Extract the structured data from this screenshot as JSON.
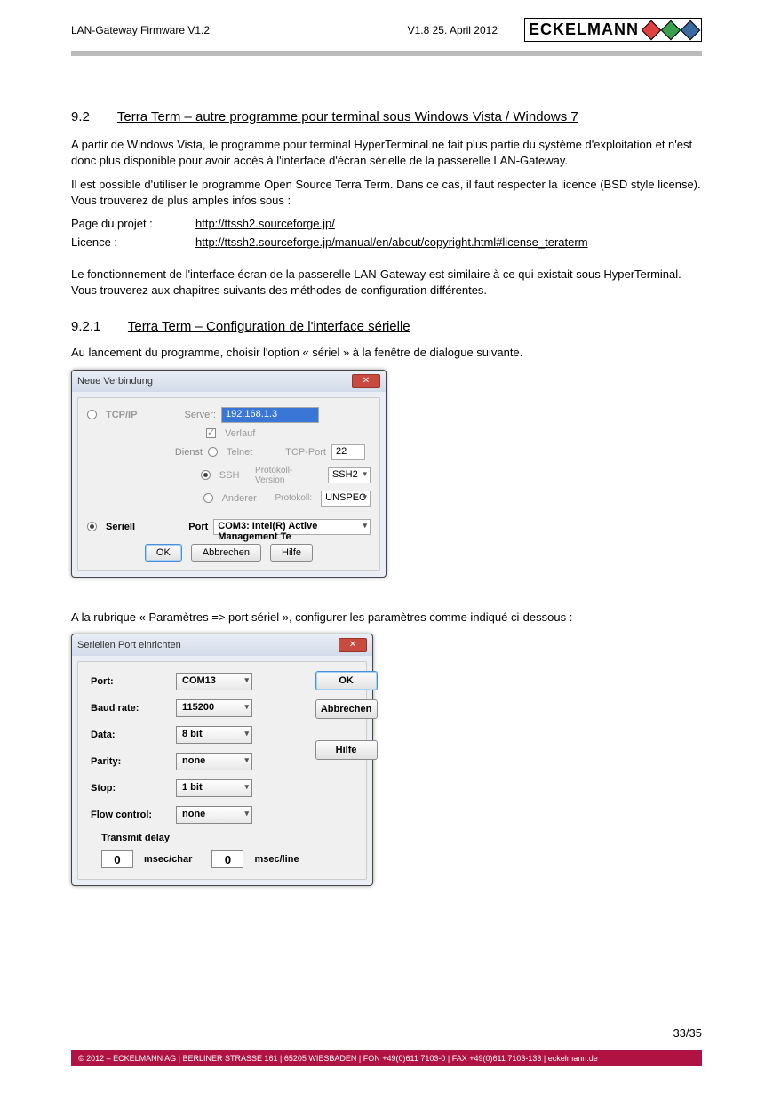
{
  "header": {
    "doc_title": "LAN-Gateway Firmware V1.2",
    "version_date": "V1.8    25. April 2012",
    "logo_text": "ECKELMANN"
  },
  "section": {
    "num": "9.2",
    "title": "Terra Term – autre programme pour terminal sous Windows Vista / Windows 7",
    "p1": "A partir de Windows Vista, le programme pour terminal HyperTerminal ne fait plus partie du système d'exploitation et n'est donc plus disponible pour avoir accès à l'interface d'écran sérielle de la passerelle LAN-Gateway.",
    "p2": "Il est possible d'utiliser le programme Open Source Terra Term. Dans ce cas, il faut respecter la licence (BSD style license). Vous trouverez de plus amples infos sous :",
    "link_project_label": "Page du projet :",
    "link_project_url": "http://ttssh2.sourceforge.jp/",
    "link_license_label": "Licence :",
    "link_license_url": "http://ttssh2.sourceforge.jp/manual/en/about/copyright.html#license_teraterm",
    "p3": "Le fonctionnement de l'interface écran de la passerelle LAN-Gateway est similaire à ce qui existait sous HyperTerminal. Vous trouverez aux chapitres suivants des méthodes de configuration différentes."
  },
  "subsection": {
    "num": "9.2.1",
    "title": "Terra Term – Configuration de l'interface sérielle",
    "intro": "Au lancement du programme, choisir l'option « sériel » à la fenêtre de dialogue suivante.",
    "intro2": "A la rubrique « Paramètres => port sériel », configurer les paramètres comme indiqué ci-dessous :"
  },
  "dlg1": {
    "title": "Neue Verbindung",
    "tcpip": "TCP/IP",
    "server_lbl": "Server:",
    "server_val": "192.168.1.3",
    "verlauf": "Verlauf",
    "dienst": "Dienst",
    "telnet": "Telnet",
    "ssh": "SSH",
    "anderer": "Anderer",
    "tcp_port_lbl": "TCP-Port",
    "tcp_port_val": "22",
    "proto_ver_lbl": "Protokoll-Version",
    "proto_ver_val": "SSH2",
    "proto_lbl": "Protokoll:",
    "proto_val": "UNSPEC",
    "seriell": "Seriell",
    "port_lbl": "Port",
    "port_val": "COM3: Intel(R) Active Management Te",
    "ok": "OK",
    "cancel": "Abbrechen",
    "help": "Hilfe"
  },
  "dlg2": {
    "title": "Seriellen Port einrichten",
    "port_lbl": "Port:",
    "port_val": "COM13",
    "baud_lbl": "Baud rate:",
    "baud_val": "115200",
    "data_lbl": "Data:",
    "data_val": "8 bit",
    "parity_lbl": "Parity:",
    "parity_val": "none",
    "stop_lbl": "Stop:",
    "stop_val": "1 bit",
    "flow_lbl": "Flow control:",
    "flow_val": "none",
    "ok": "OK",
    "cancel": "Abbrechen",
    "help": "Hilfe",
    "transmit_title": "Transmit delay",
    "msec_char_val": "0",
    "msec_char_lbl": "msec/char",
    "msec_line_val": "0",
    "msec_line_lbl": "msec/line"
  },
  "footer": {
    "page": "33/35",
    "copyright": "© 2012 – ECKELMANN AG | BERLINER STRASSE 161 | 65205 WIESBADEN | FON +49(0)611 7103-0 | FAX +49(0)611 7103-133 | eckelmann.de"
  }
}
